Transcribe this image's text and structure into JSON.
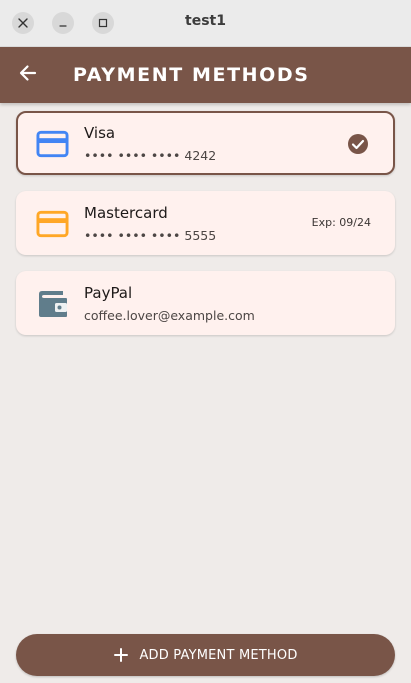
{
  "window": {
    "title": "test1",
    "controls": {
      "close_icon": "close-icon",
      "minimize_icon": "minimize-icon",
      "maximize_icon": "maximize-icon"
    }
  },
  "appbar": {
    "title": "PAYMENT METHODS",
    "back_icon": "arrow-back-icon",
    "background": "#795548"
  },
  "payment_methods": [
    {
      "name": "Visa",
      "detail": "•••• •••• •••• 4242",
      "icon": "credit-card-icon",
      "icon_color": "#4285f4",
      "selected": true,
      "status_icon": "check-circle-icon"
    },
    {
      "name": "Mastercard",
      "detail": "•••• •••• •••• 5555",
      "icon": "credit-card-icon",
      "icon_color": "#ffa726",
      "selected": false,
      "expiry": "Exp: 09/24"
    },
    {
      "name": "PayPal",
      "detail": "coffee.lover@example.com",
      "icon": "wallet-icon",
      "icon_color": "#607d8b",
      "selected": false
    }
  ],
  "add_button": {
    "label": "ADD PAYMENT METHOD",
    "icon": "plus-icon"
  },
  "colors": {
    "accent": "#795548",
    "card_background": "#fff1ee",
    "page_background": "#efebe9"
  }
}
